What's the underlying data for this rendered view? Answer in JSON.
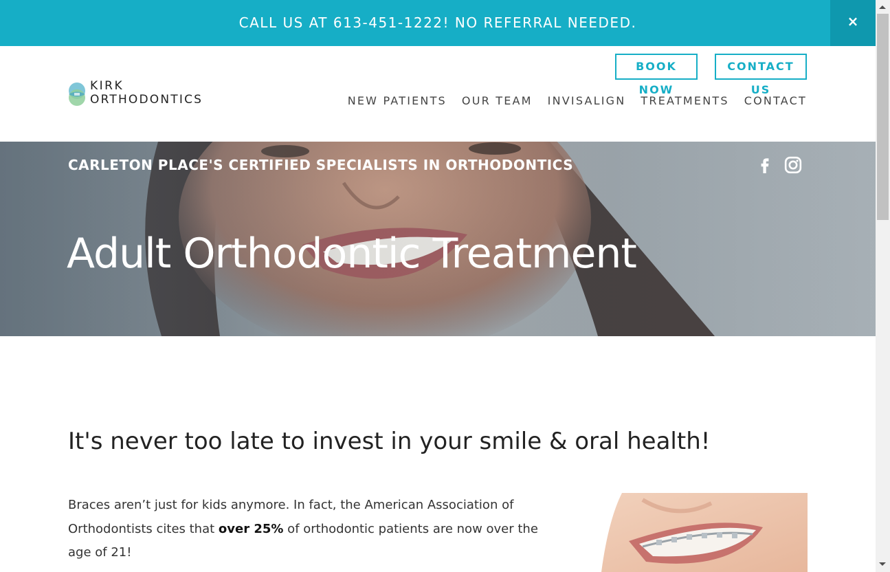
{
  "topbar": {
    "message": "CALL US AT 613-451-1222! NO REFERRAL NEEDED.",
    "close_label": "×"
  },
  "logo": {
    "line1": "KIRK",
    "line2": "ORTHODONTICS"
  },
  "header": {
    "book_label": "BOOK NOW",
    "contact_label": "CONTACT US",
    "nav": [
      "NEW PATIENTS",
      "OUR TEAM",
      "INVISALIGN",
      "TREATMENTS",
      "CONTACT"
    ]
  },
  "hero": {
    "tagline": "CARLETON PLACE'S CERTIFIED SPECIALISTS IN ORTHODONTICS",
    "title": "Adult Orthodontic Treatment",
    "social": [
      "facebook-icon",
      "instagram-icon"
    ]
  },
  "content": {
    "heading": "It's never too late to invest in your smile & oral health!",
    "para_before": "Braces aren’t just for kids anymore. In fact, the American Association of Orthodontists cites that ",
    "para_bold": "over 25%",
    "para_after": " of orthodontic patients are now over the age of 21!"
  },
  "colors": {
    "accent": "#16aec6",
    "accent_dark": "#0f98ae",
    "text": "#333333"
  }
}
